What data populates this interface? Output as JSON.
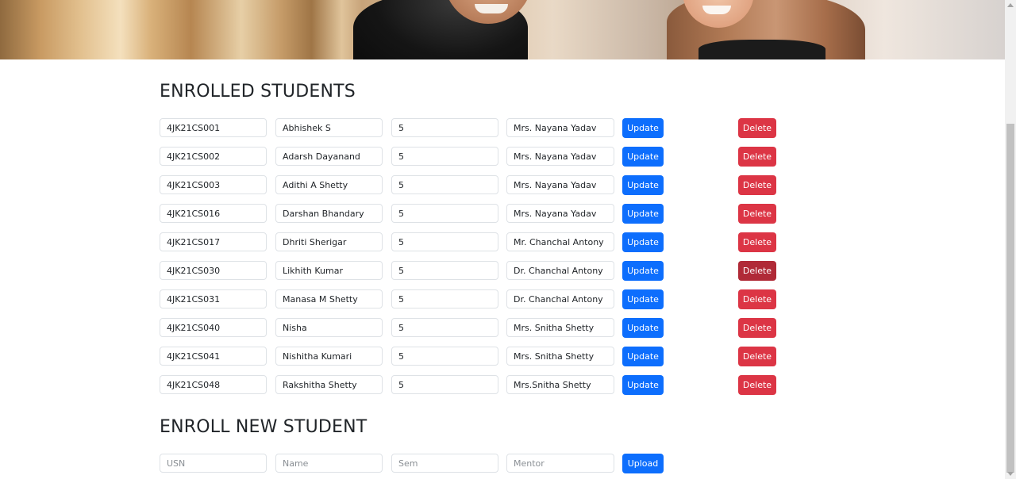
{
  "enrolled": {
    "title": "ENROLLED STUDENTS",
    "update_label": "Update",
    "delete_label": "Delete",
    "students": [
      {
        "usn": "4JK21CS001",
        "name": "Abhishek S",
        "sem": "5",
        "mentor": "Mrs. Nayana Yadav"
      },
      {
        "usn": "4JK21CS002",
        "name": "Adarsh Dayanand",
        "sem": "5",
        "mentor": "Mrs. Nayana Yadav"
      },
      {
        "usn": "4JK21CS003",
        "name": "Adithi A Shetty",
        "sem": "5",
        "mentor": "Mrs. Nayana Yadav"
      },
      {
        "usn": "4JK21CS016",
        "name": "Darshan Bhandary",
        "sem": "5",
        "mentor": "Mrs. Nayana Yadav"
      },
      {
        "usn": "4JK21CS017",
        "name": "Dhriti Sherigar",
        "sem": "5",
        "mentor": "Mr. Chanchal Antony"
      },
      {
        "usn": "4JK21CS030",
        "name": "Likhith Kumar",
        "sem": "5",
        "mentor": "Dr. Chanchal Antony"
      },
      {
        "usn": "4JK21CS031",
        "name": "Manasa M Shetty",
        "sem": "5",
        "mentor": "Dr. Chanchal Antony"
      },
      {
        "usn": "4JK21CS040",
        "name": "Nisha",
        "sem": "5",
        "mentor": "Mrs. Snitha Shetty"
      },
      {
        "usn": "4JK21CS041",
        "name": "Nishitha Kumari",
        "sem": "5",
        "mentor": "Mrs. Snitha Shetty"
      },
      {
        "usn": "4JK21CS048",
        "name": "Rakshitha Shetty",
        "sem": "5",
        "mentor": "Mrs.Snitha Shetty"
      }
    ]
  },
  "new_student": {
    "title": "ENROLL NEW STUDENT",
    "usn_placeholder": "USN",
    "name_placeholder": "Name",
    "sem_placeholder": "Sem",
    "mentor_placeholder": "Mentor",
    "upload_label": "Upload"
  },
  "colors": {
    "update": "#0d6efd",
    "delete": "#dc3545",
    "delete_hover": "#b02a37"
  }
}
